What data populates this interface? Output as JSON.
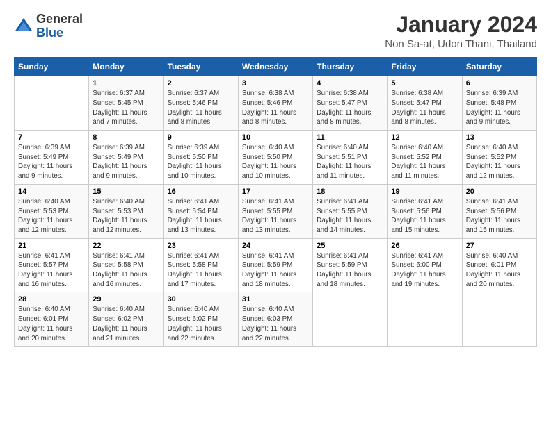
{
  "logo": {
    "general": "General",
    "blue": "Blue"
  },
  "title": "January 2024",
  "subtitle": "Non Sa-at, Udon Thani, Thailand",
  "days_of_week": [
    "Sunday",
    "Monday",
    "Tuesday",
    "Wednesday",
    "Thursday",
    "Friday",
    "Saturday"
  ],
  "weeks": [
    [
      {
        "day": "",
        "info": ""
      },
      {
        "day": "1",
        "info": "Sunrise: 6:37 AM\nSunset: 5:45 PM\nDaylight: 11 hours\nand 7 minutes."
      },
      {
        "day": "2",
        "info": "Sunrise: 6:37 AM\nSunset: 5:46 PM\nDaylight: 11 hours\nand 8 minutes."
      },
      {
        "day": "3",
        "info": "Sunrise: 6:38 AM\nSunset: 5:46 PM\nDaylight: 11 hours\nand 8 minutes."
      },
      {
        "day": "4",
        "info": "Sunrise: 6:38 AM\nSunset: 5:47 PM\nDaylight: 11 hours\nand 8 minutes."
      },
      {
        "day": "5",
        "info": "Sunrise: 6:38 AM\nSunset: 5:47 PM\nDaylight: 11 hours\nand 8 minutes."
      },
      {
        "day": "6",
        "info": "Sunrise: 6:39 AM\nSunset: 5:48 PM\nDaylight: 11 hours\nand 9 minutes."
      }
    ],
    [
      {
        "day": "7",
        "info": "Sunrise: 6:39 AM\nSunset: 5:49 PM\nDaylight: 11 hours\nand 9 minutes."
      },
      {
        "day": "8",
        "info": "Sunrise: 6:39 AM\nSunset: 5:49 PM\nDaylight: 11 hours\nand 9 minutes."
      },
      {
        "day": "9",
        "info": "Sunrise: 6:39 AM\nSunset: 5:50 PM\nDaylight: 11 hours\nand 10 minutes."
      },
      {
        "day": "10",
        "info": "Sunrise: 6:40 AM\nSunset: 5:50 PM\nDaylight: 11 hours\nand 10 minutes."
      },
      {
        "day": "11",
        "info": "Sunrise: 6:40 AM\nSunset: 5:51 PM\nDaylight: 11 hours\nand 11 minutes."
      },
      {
        "day": "12",
        "info": "Sunrise: 6:40 AM\nSunset: 5:52 PM\nDaylight: 11 hours\nand 11 minutes."
      },
      {
        "day": "13",
        "info": "Sunrise: 6:40 AM\nSunset: 5:52 PM\nDaylight: 11 hours\nand 12 minutes."
      }
    ],
    [
      {
        "day": "14",
        "info": "Sunrise: 6:40 AM\nSunset: 5:53 PM\nDaylight: 11 hours\nand 12 minutes."
      },
      {
        "day": "15",
        "info": "Sunrise: 6:40 AM\nSunset: 5:53 PM\nDaylight: 11 hours\nand 12 minutes."
      },
      {
        "day": "16",
        "info": "Sunrise: 6:41 AM\nSunset: 5:54 PM\nDaylight: 11 hours\nand 13 minutes."
      },
      {
        "day": "17",
        "info": "Sunrise: 6:41 AM\nSunset: 5:55 PM\nDaylight: 11 hours\nand 13 minutes."
      },
      {
        "day": "18",
        "info": "Sunrise: 6:41 AM\nSunset: 5:55 PM\nDaylight: 11 hours\nand 14 minutes."
      },
      {
        "day": "19",
        "info": "Sunrise: 6:41 AM\nSunset: 5:56 PM\nDaylight: 11 hours\nand 15 minutes."
      },
      {
        "day": "20",
        "info": "Sunrise: 6:41 AM\nSunset: 5:56 PM\nDaylight: 11 hours\nand 15 minutes."
      }
    ],
    [
      {
        "day": "21",
        "info": "Sunrise: 6:41 AM\nSunset: 5:57 PM\nDaylight: 11 hours\nand 16 minutes."
      },
      {
        "day": "22",
        "info": "Sunrise: 6:41 AM\nSunset: 5:58 PM\nDaylight: 11 hours\nand 16 minutes."
      },
      {
        "day": "23",
        "info": "Sunrise: 6:41 AM\nSunset: 5:58 PM\nDaylight: 11 hours\nand 17 minutes."
      },
      {
        "day": "24",
        "info": "Sunrise: 6:41 AM\nSunset: 5:59 PM\nDaylight: 11 hours\nand 18 minutes."
      },
      {
        "day": "25",
        "info": "Sunrise: 6:41 AM\nSunset: 5:59 PM\nDaylight: 11 hours\nand 18 minutes."
      },
      {
        "day": "26",
        "info": "Sunrise: 6:41 AM\nSunset: 6:00 PM\nDaylight: 11 hours\nand 19 minutes."
      },
      {
        "day": "27",
        "info": "Sunrise: 6:40 AM\nSunset: 6:01 PM\nDaylight: 11 hours\nand 20 minutes."
      }
    ],
    [
      {
        "day": "28",
        "info": "Sunrise: 6:40 AM\nSunset: 6:01 PM\nDaylight: 11 hours\nand 20 minutes."
      },
      {
        "day": "29",
        "info": "Sunrise: 6:40 AM\nSunset: 6:02 PM\nDaylight: 11 hours\nand 21 minutes."
      },
      {
        "day": "30",
        "info": "Sunrise: 6:40 AM\nSunset: 6:02 PM\nDaylight: 11 hours\nand 22 minutes."
      },
      {
        "day": "31",
        "info": "Sunrise: 6:40 AM\nSunset: 6:03 PM\nDaylight: 11 hours\nand 22 minutes."
      },
      {
        "day": "",
        "info": ""
      },
      {
        "day": "",
        "info": ""
      },
      {
        "day": "",
        "info": ""
      }
    ]
  ]
}
